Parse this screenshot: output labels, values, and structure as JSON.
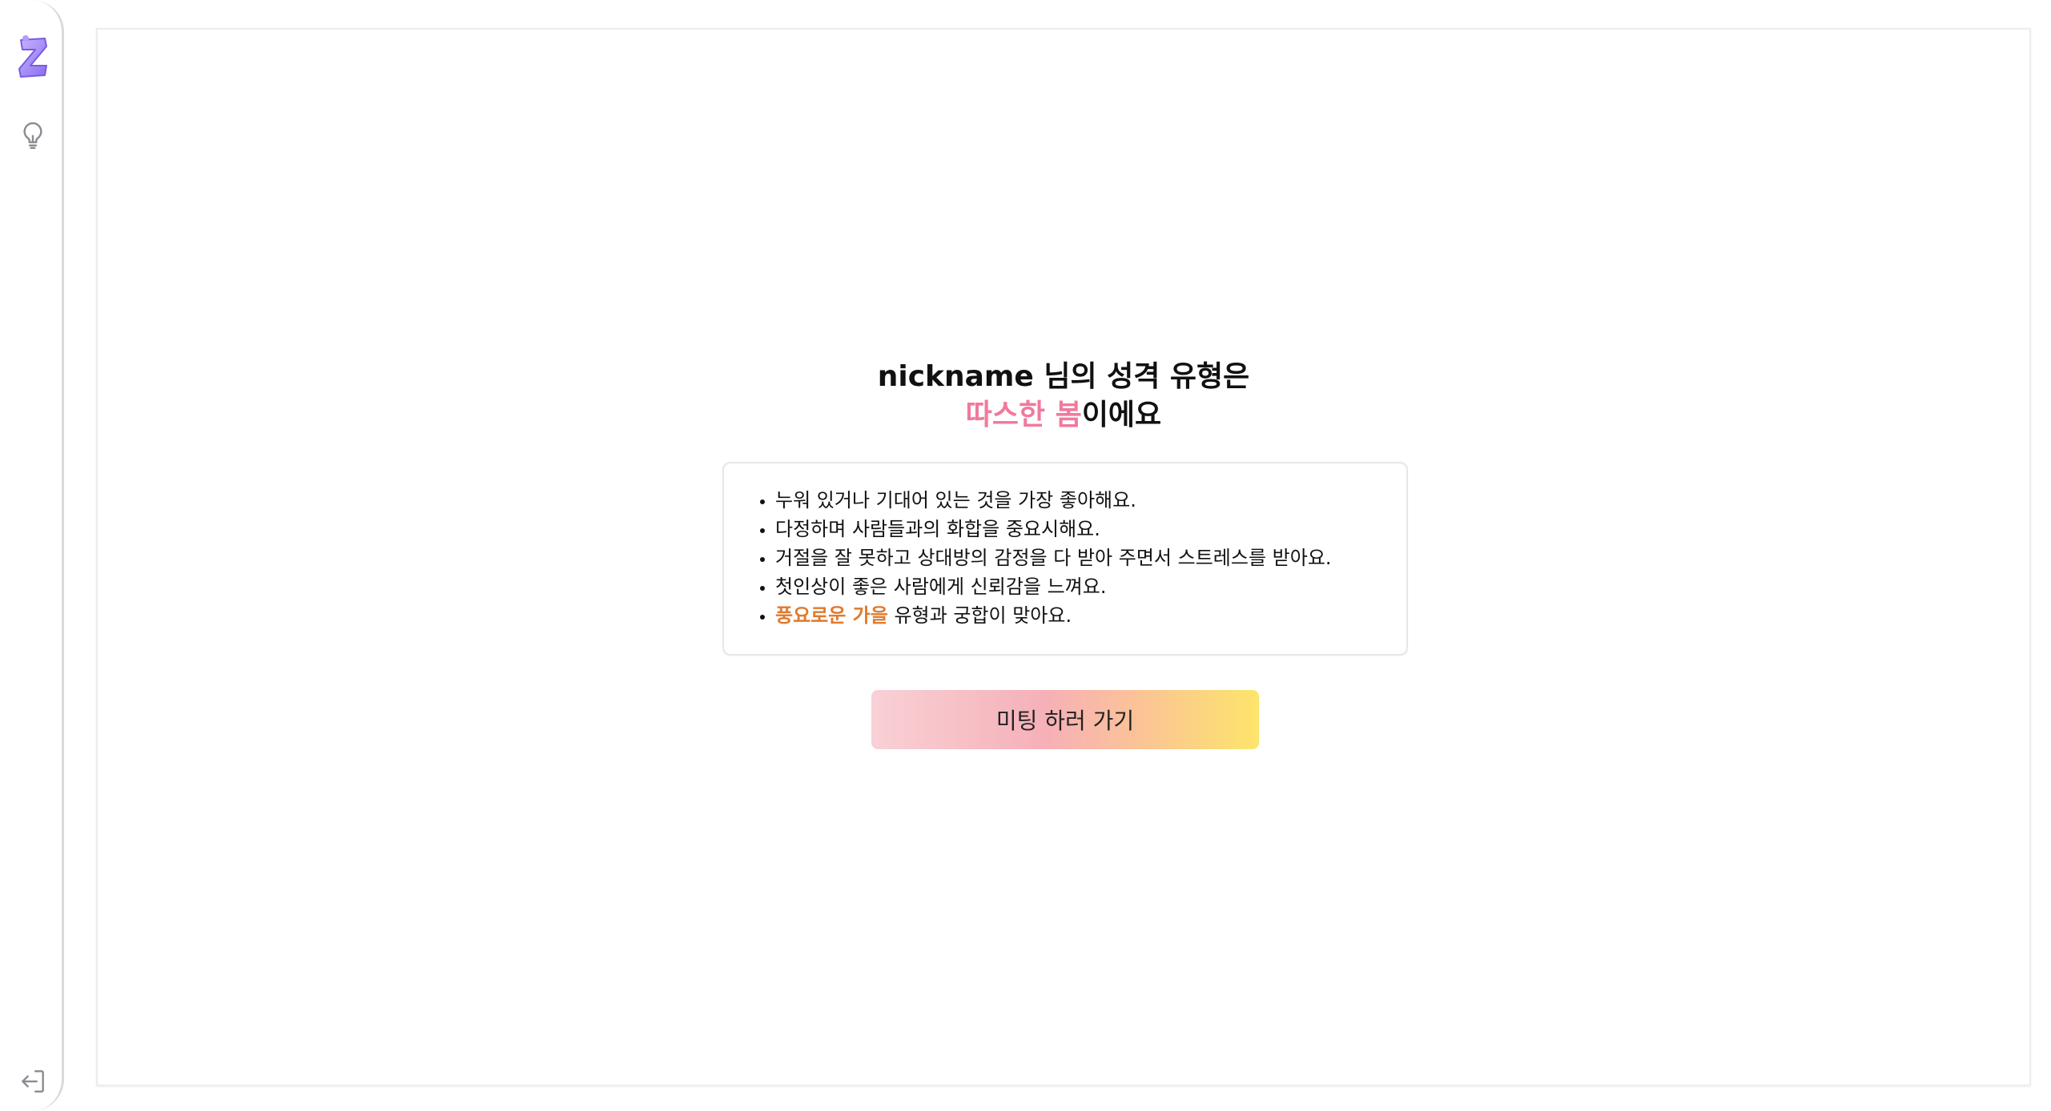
{
  "sidebar": {
    "logo_icon": "z-logo-icon",
    "items": [
      {
        "icon": "lightbulb-icon"
      }
    ],
    "footer_icon": "logout-icon"
  },
  "result": {
    "title_line1": "nickname 님의 성격 유형은",
    "type_name": "따스한 봄",
    "title_suffix": "이에요",
    "traits": [
      "누워 있거나 기대어 있는 것을 가장 좋아해요.",
      "다정하며 사람들과의 화합을 중요시해요.",
      "거절을 잘 못하고 상대방의 감정을 다 받아 주면서 스트레스를 받아요.",
      "첫인상이 좋은 사람에게 신뢰감을 느껴요."
    ],
    "match": {
      "type": "풍요로운 가을",
      "suffix": " 유형과 궁합이 맞아요."
    },
    "cta_label": "미팅 하러 가기"
  },
  "colors": {
    "accent_pink": "#f17a9c",
    "accent_orange": "#e07a2e",
    "logo_purple": "#9b7ef0"
  }
}
